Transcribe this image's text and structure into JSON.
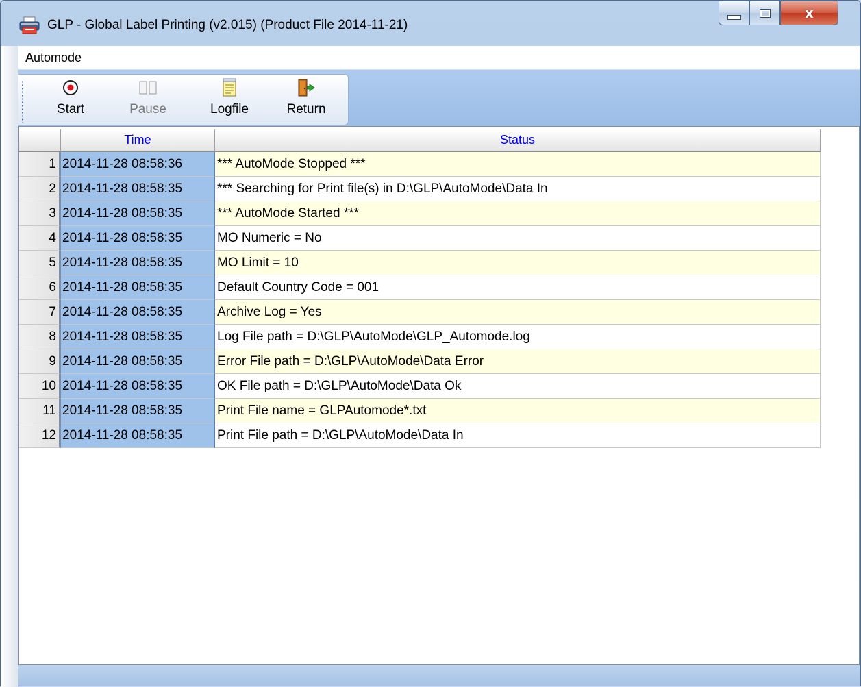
{
  "window": {
    "title": "GLP - Global Label Printing (v2.015) (Product File 2014-11-21)",
    "close_glyph": "x"
  },
  "menu": {
    "items": [
      "Automode"
    ]
  },
  "toolbar": {
    "start_label": "Start",
    "pause_label": "Pause",
    "logfile_label": "Logfile",
    "return_label": "Return"
  },
  "grid": {
    "columns": [
      "Time",
      "Status"
    ],
    "rows": [
      {
        "num": "1",
        "time": "2014-11-28 08:58:36",
        "status": "*** AutoMode Stopped ***"
      },
      {
        "num": "2",
        "time": "2014-11-28 08:58:35",
        "status": "*** Searching for Print file(s) in D:\\GLP\\AutoMode\\Data In"
      },
      {
        "num": "3",
        "time": "2014-11-28 08:58:35",
        "status": "*** AutoMode Started ***"
      },
      {
        "num": "4",
        "time": "2014-11-28 08:58:35",
        "status": "MO Numeric = No"
      },
      {
        "num": "5",
        "time": "2014-11-28 08:58:35",
        "status": "MO Limit = 10"
      },
      {
        "num": "6",
        "time": "2014-11-28 08:58:35",
        "status": "Default Country Code = 001"
      },
      {
        "num": "7",
        "time": "2014-11-28 08:58:35",
        "status": "Archive Log = Yes"
      },
      {
        "num": "8",
        "time": "2014-11-28 08:58:35",
        "status": "Log File path = D:\\GLP\\AutoMode\\GLP_Automode.log"
      },
      {
        "num": "9",
        "time": "2014-11-28 08:58:35",
        "status": "Error File path = D:\\GLP\\AutoMode\\Data Error"
      },
      {
        "num": "10",
        "time": "2014-11-28 08:58:35",
        "status": "OK File path = D:\\GLP\\AutoMode\\Data Ok"
      },
      {
        "num": "11",
        "time": "2014-11-28 08:58:35",
        "status": "Print File name = GLPAutomode*.txt"
      },
      {
        "num": "12",
        "time": "2014-11-28 08:58:35",
        "status": "Print File path = D:\\GLP\\AutoMode\\Data In"
      }
    ]
  },
  "colors": {
    "header_text": "#0000ee",
    "time_cell_bg": "#9fc2ea",
    "status_odd_bg": "#ffffe1",
    "record_icon": "#e0101e"
  },
  "icons": {
    "app": "printer-icon",
    "start": "record-icon",
    "pause": "pause-icon",
    "logfile": "notepad-icon",
    "return": "door-exit-icon"
  }
}
